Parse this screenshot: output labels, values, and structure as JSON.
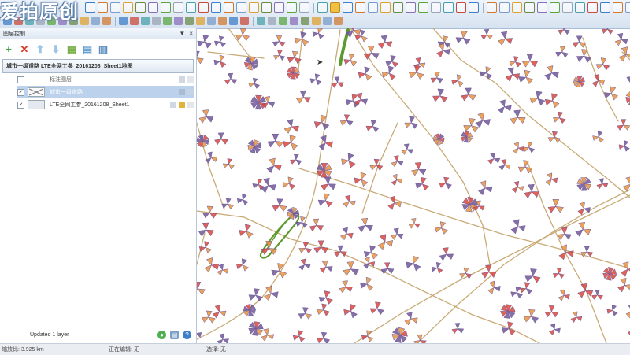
{
  "watermark": "爱拍原创",
  "layers_panel": {
    "title": "图层控制",
    "controls": [
      "▼",
      "×"
    ],
    "map_name": "城市一级道路 LTE全网工参_20161208_Sheet1地图",
    "layers": [
      {
        "name": "标注图层",
        "checked": false,
        "selected": false
      },
      {
        "name": "城市一级道路",
        "checked": true,
        "selected": true
      },
      {
        "name": "LTE全网工参_20161208_Sheet1",
        "checked": true,
        "selected": false
      }
    ],
    "status": "Updated 1 layer"
  },
  "statusbar": {
    "scale": "缩放比: 3.925 km",
    "edit_layer": "正在编辑: 无",
    "select": "选择: 无"
  },
  "colors": {
    "road": "#c9aa76",
    "green_feature": "#5d9a2e",
    "site_red": "#d9473b",
    "site_purple": "#6e5796",
    "site_orange": "#e8923d"
  },
  "icons": {
    "add": "add-layer-icon",
    "remove": "remove-layer-icon"
  }
}
